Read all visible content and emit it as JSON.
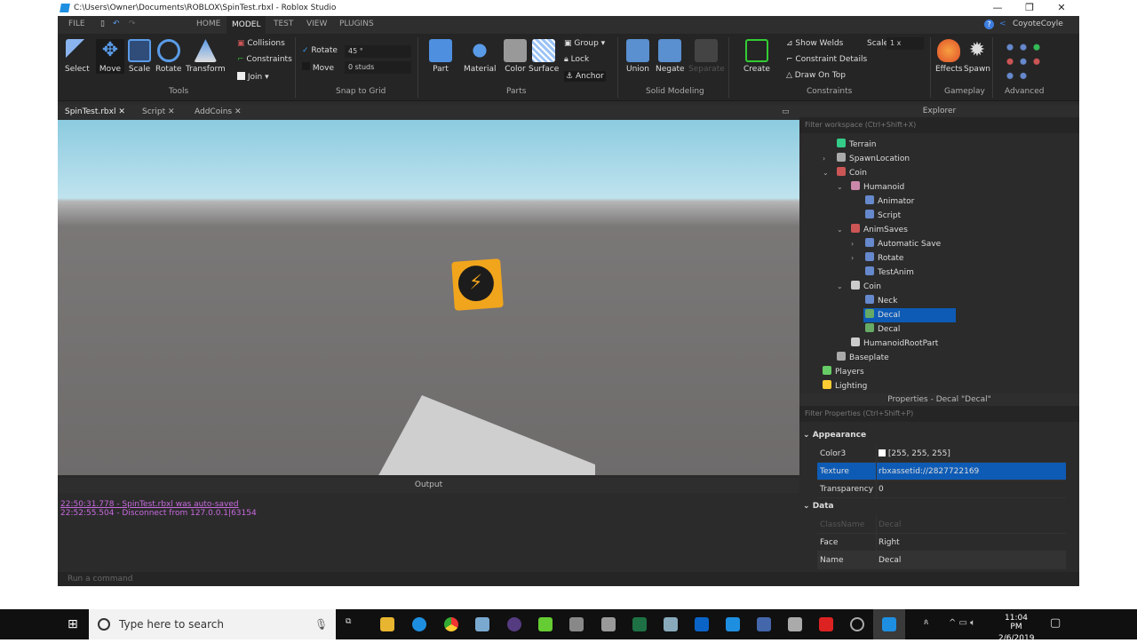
{
  "window": {
    "title": "C:\\Users\\Owner\\Documents\\ROBLOX\\SpinTest.rbxl - Roblox Studio",
    "minimize": "—",
    "maximize": "❐",
    "close": "✕"
  },
  "menu": {
    "file": "FILE",
    "tabs": [
      "HOME",
      "MODEL",
      "TEST",
      "VIEW",
      "PLUGINS"
    ],
    "active": "MODEL",
    "user": "CoyoteCoyle",
    "help": "?"
  },
  "ribbon": {
    "tools": [
      "Select",
      "Move",
      "Scale",
      "Rotate",
      "Transform"
    ],
    "tools_group": "Tools",
    "collisions": "Collisions",
    "constraints": "Constraints",
    "join": "Join",
    "snap": {
      "rotate_label": "Rotate",
      "rotate_value": "45 °",
      "rotate_checked": true,
      "move_label": "Move",
      "move_value": "0 studs",
      "move_checked": false,
      "group": "Snap to Grid"
    },
    "parts": [
      "Part",
      "Material",
      "Color",
      "Surface"
    ],
    "group_btn": "Group",
    "lock": "Lock",
    "anchor": "Anchor",
    "parts_group": "Parts",
    "solid": [
      "Union",
      "Negate",
      "Separate"
    ],
    "solid_group": "Solid Modeling",
    "create": "Create",
    "show_welds": "Show Welds",
    "constraint_details": "Constraint Details",
    "draw_on_top": "Draw On Top",
    "scale_label": "Scale",
    "scale_value": "1 x",
    "constraints_group": "Constraints",
    "effects": "Effects",
    "spawn": "Spawn",
    "gameplay_group": "Gameplay",
    "advanced_group": "Advanced"
  },
  "doc_tabs": [
    "SpinTest.rbxl",
    "Script",
    "AddCoins"
  ],
  "output": {
    "title": "Output",
    "lines": [
      "22:50:31.778 - SpinTest.rbxl was auto-saved",
      "22:52:55.504 - Disconnect from 127.0.0.1|63154"
    ]
  },
  "command": {
    "placeholder": "Run a command"
  },
  "explorer": {
    "title": "Explorer",
    "filter": "Filter workspace (Ctrl+Shift+X)",
    "items": [
      "Terrain",
      "SpawnLocation",
      "Coin",
      "Humanoid",
      "Animator",
      "Script",
      "AnimSaves",
      "Automatic Save",
      "Rotate",
      "TestAnim",
      "Coin",
      "Neck",
      "Decal",
      "Decal",
      "HumanoidRootPart",
      "Baseplate",
      "Players",
      "Lighting"
    ],
    "selected": "Decal"
  },
  "properties": {
    "title": "Properties - Decal \"Decal\"",
    "filter": "Filter Properties (Ctrl+Shift+P)",
    "sections": [
      "Appearance",
      "Data"
    ],
    "rows": [
      {
        "k": "Color3",
        "v": "[255, 255, 255]"
      },
      {
        "k": "Texture",
        "v": "rbxassetid://2827722169"
      },
      {
        "k": "Transparency",
        "v": "0"
      },
      {
        "k": "ClassName",
        "v": "Decal"
      },
      {
        "k": "Face",
        "v": "Right"
      },
      {
        "k": "Name",
        "v": "Decal"
      }
    ]
  },
  "taskbar": {
    "search": "Type here to search",
    "time": "11:04 PM",
    "date": "2/6/2019"
  },
  "colors": {
    "accent": "#0e5bb5",
    "output_text": "#c86adf"
  }
}
